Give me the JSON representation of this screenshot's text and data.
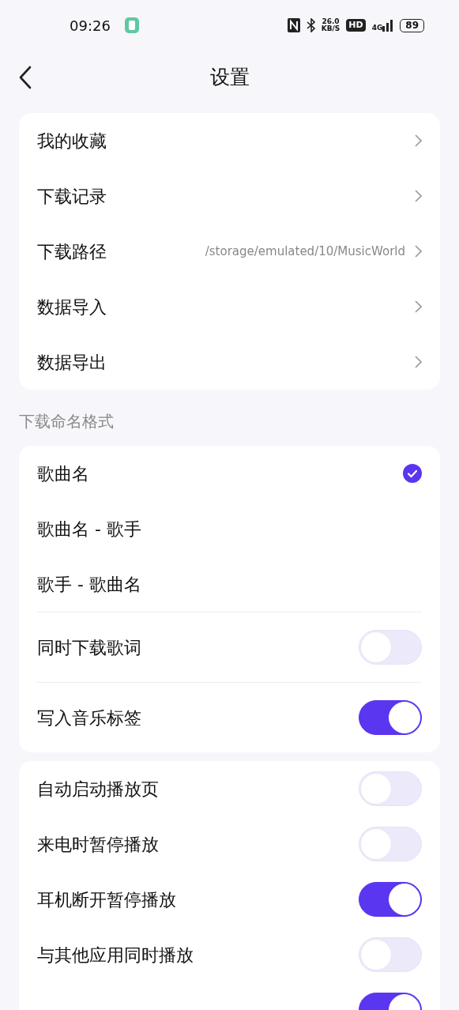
{
  "status_bar": {
    "time": "09:26",
    "speed_value": "26.0",
    "speed_unit": "KB/S",
    "hd": "HD",
    "network": "4G",
    "battery": "89"
  },
  "header": {
    "title": "设置"
  },
  "sections": [
    {
      "groups": [
        [
          {
            "kind": "link",
            "label": "我的收藏"
          },
          {
            "kind": "link",
            "label": "下载记录"
          },
          {
            "kind": "link",
            "label": "下载路径",
            "value": "/storage/emulated/10/MusicWorld"
          },
          {
            "kind": "link",
            "label": "数据导入"
          },
          {
            "kind": "link",
            "label": "数据导出"
          }
        ]
      ]
    },
    {
      "heading": "下载命名格式",
      "groups": [
        [
          {
            "kind": "radio",
            "label": "歌曲名",
            "selected": true
          },
          {
            "kind": "radio",
            "label": "歌曲名 - 歌手",
            "selected": false
          },
          {
            "kind": "radio",
            "label": "歌手 - 歌曲名",
            "selected": false
          }
        ],
        [
          {
            "kind": "toggle",
            "label": "同时下载歌词",
            "on": false
          }
        ],
        [
          {
            "kind": "toggle",
            "label": "写入音乐标签",
            "on": true
          }
        ]
      ]
    },
    {
      "groups": [
        [
          {
            "kind": "toggle",
            "label": "自动启动播放页",
            "on": false
          },
          {
            "kind": "toggle",
            "label": "来电时暂停播放",
            "on": false
          },
          {
            "kind": "toggle",
            "label": "耳机断开暂停播放",
            "on": true
          },
          {
            "kind": "toggle",
            "label": "与其他应用同时播放",
            "on": false
          },
          {
            "kind": "toggle",
            "on": true
          }
        ]
      ]
    }
  ]
}
